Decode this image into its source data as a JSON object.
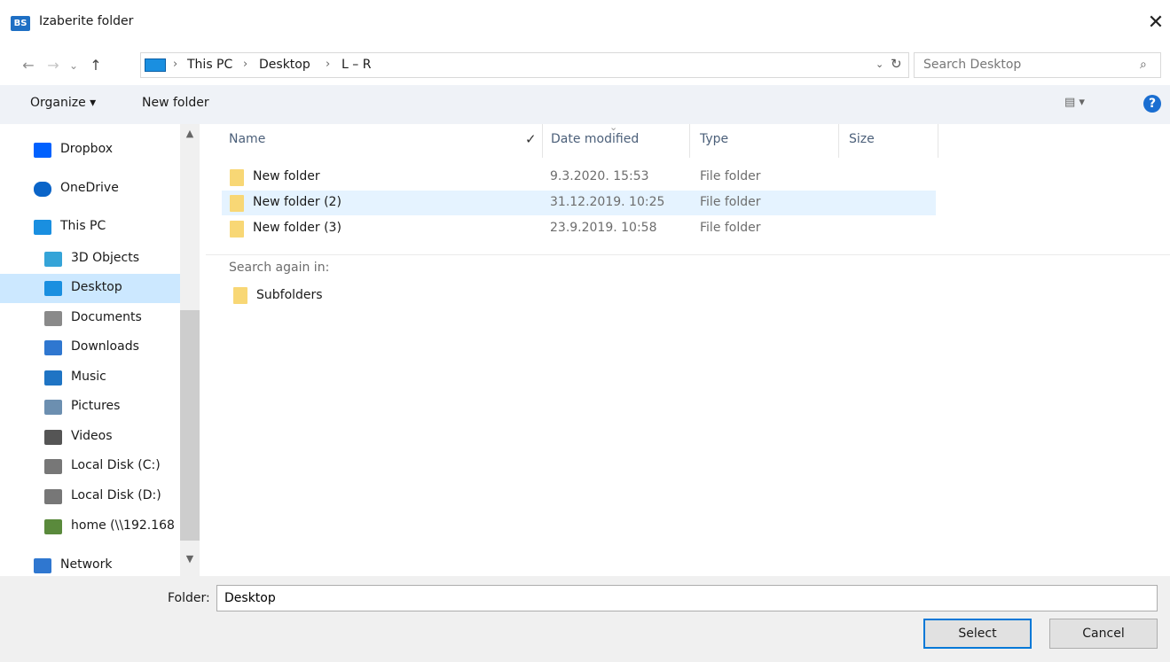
{
  "window": {
    "title": "Izaberite folder",
    "app_icon_text": "BS",
    "close_glyph": "✕"
  },
  "nav_buttons": {
    "back": "←",
    "forward": "→",
    "recent": "⌄",
    "up": "↑"
  },
  "address": {
    "crumbs": [
      "This PC",
      "Desktop",
      "L – R"
    ],
    "separator": "›",
    "dropdown": "⌄",
    "refresh": "↻"
  },
  "search": {
    "placeholder": "Search Desktop",
    "icon": "⌕"
  },
  "toolbar": {
    "organize": "Organize ▾",
    "new_folder": "New folder",
    "view": "▤ ▾",
    "help": "?"
  },
  "nav_pane": {
    "items": [
      {
        "label": "Dropbox",
        "icon": "dropbox-icon",
        "color": "#0061fe"
      },
      {
        "label": "OneDrive",
        "icon": "onedrive-icon",
        "color": "#0a64c8"
      },
      {
        "label": "This PC",
        "icon": "pc-icon",
        "color": "#1a8fe0"
      },
      {
        "label": "3D Objects",
        "icon": "3d-objects-icon",
        "color": "#35a4d8"
      },
      {
        "label": "Desktop",
        "icon": "desktop-icon",
        "color": "#1a8fe0",
        "selected": true
      },
      {
        "label": "Documents",
        "icon": "documents-icon",
        "color": "#8a8a8a"
      },
      {
        "label": "Downloads",
        "icon": "downloads-icon",
        "color": "#2f77d0"
      },
      {
        "label": "Music",
        "icon": "music-icon",
        "color": "#1f74c4"
      },
      {
        "label": "Pictures",
        "icon": "pictures-icon",
        "color": "#6c8fb0"
      },
      {
        "label": "Videos",
        "icon": "videos-icon",
        "color": "#555555"
      },
      {
        "label": "Local Disk (C:)",
        "icon": "drive-c-icon",
        "color": "#777777"
      },
      {
        "label": "Local Disk (D:)",
        "icon": "drive-d-icon",
        "color": "#777777"
      },
      {
        "label": "home (\\\\192.168",
        "icon": "network-drive-icon",
        "color": "#5a8a3c"
      },
      {
        "label": "Network",
        "icon": "network-icon",
        "color": "#2f77d0"
      }
    ],
    "scroll_up": "▲",
    "scroll_down": "▼"
  },
  "file_list": {
    "columns": {
      "name": "Name",
      "date": "Date modified",
      "type": "Type",
      "size": "Size"
    },
    "sort_indicator": "⌄",
    "check_glyph": "✓",
    "rows": [
      {
        "name": "New folder",
        "date": "9.3.2020. 15:53",
        "type": "File folder"
      },
      {
        "name": "New folder (2)",
        "date": "31.12.2019. 10:25",
        "type": "File folder",
        "highlighted": true
      },
      {
        "name": "New folder (3)",
        "date": "23.9.2019. 10:58",
        "type": "File folder"
      }
    ],
    "search_again_label": "Search again in:",
    "subfolders_label": "Subfolders"
  },
  "bottom": {
    "folder_label": "Folder:",
    "folder_value": "Desktop",
    "select": "Select",
    "cancel": "Cancel"
  },
  "colors": {
    "accent": "#0078d7",
    "selection": "#cce8ff",
    "hover_row": "#e5f3ff",
    "folder": "#f8d775"
  }
}
